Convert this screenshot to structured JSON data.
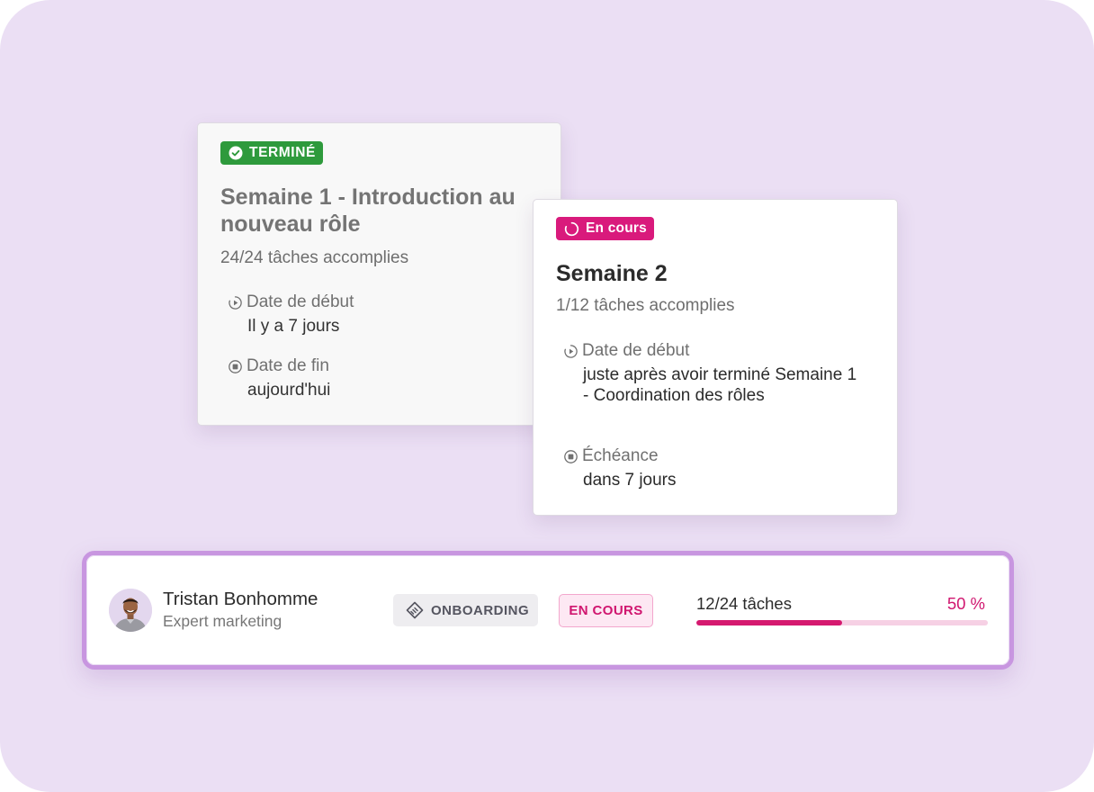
{
  "week1_card": {
    "badge": "TERMINÉ",
    "title": "Semaine 1 - Introduction au nouveau rôle",
    "tasks": "24/24 tâches accomplies",
    "start_label": "Date de début",
    "start_value": "Il y a 7 jours",
    "end_label": "Date de fin",
    "end_value": "aujourd'hui"
  },
  "week2_card": {
    "badge": "En cours",
    "title": "Semaine 2",
    "tasks": "1/12 tâches accomplies",
    "start_label": "Date de début",
    "start_value": "juste après avoir terminé Semaine 1 - Coordination des rôles",
    "due_label": "Échéance",
    "due_value": "dans 7 jours"
  },
  "employee_row": {
    "name": "Tristan Bonhomme",
    "role": "Expert marketing",
    "program_tag": "ONBOARDING",
    "status_tag": "EN COURS",
    "progress_text": "12/24 tâches",
    "progress_percent_label": "50 %",
    "progress_fraction": 0.5
  },
  "colors": {
    "background": "#ebdff4",
    "done_green": "#2e9a3c",
    "in_progress_pink": "#d91a7c",
    "strip_border": "#c896e0",
    "progress_track": "#f6d0e4"
  },
  "icons": {
    "done": "check-circle-icon",
    "in_progress": "spinner-icon",
    "start": "play-circle-icon",
    "end": "stop-circle-icon",
    "onboarding": "handshake-icon"
  }
}
